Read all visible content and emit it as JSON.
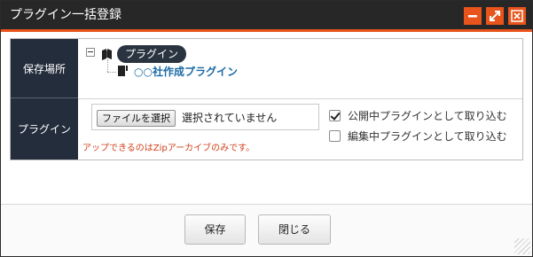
{
  "window": {
    "title": "プラグイン一括登録",
    "accent_color": "#e8541b",
    "titlebar_color": "#272727",
    "controls": [
      {
        "name": "minimize-icon"
      },
      {
        "name": "maximize-icon"
      },
      {
        "name": "close-icon"
      }
    ]
  },
  "form": {
    "location": {
      "label": "保存場所",
      "tree": {
        "root": {
          "label": "プラグイン",
          "icon": "folder-icon",
          "expanded": true
        },
        "children": [
          {
            "label": "○○社作成プラグイン",
            "icon": "plugin-icon"
          }
        ]
      }
    },
    "plugin": {
      "label": "プラグイン",
      "file_button_label": "ファイルを選択",
      "file_status": "選択されていません",
      "hint": "アップできるのはZipアーカイブのみです。",
      "options": [
        {
          "label": "公開中プラグインとして取り込む",
          "checked": true
        },
        {
          "label": "編集中プラグインとして取り込む",
          "checked": false
        }
      ]
    },
    "label_bg_color": "#232d3b",
    "hint_color": "#d1421c",
    "link_color": "#1a6aa6"
  },
  "footer": {
    "save_label": "保存",
    "close_label": "閉じる"
  }
}
